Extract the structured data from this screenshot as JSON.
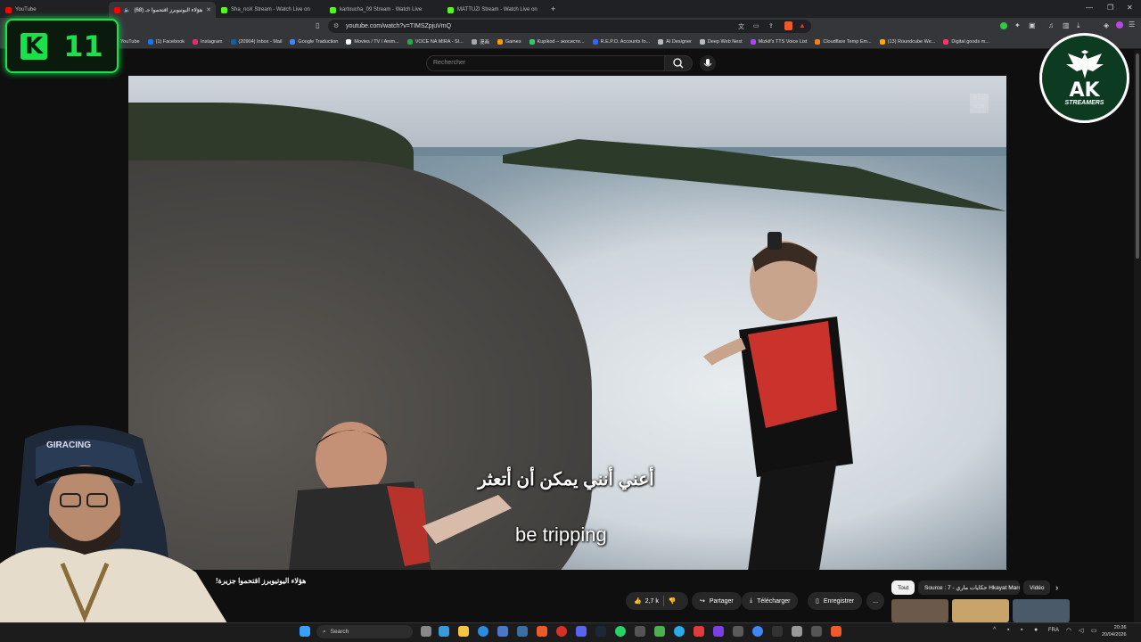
{
  "browser": {
    "tabs": [
      {
        "title": "YouTube",
        "active": false,
        "favicon_color": "#ff0000"
      },
      {
        "title": "هؤلاء اليوتيوبرز اقتحموا جـ (68)",
        "active": true,
        "favicon_color": "#ff0000"
      },
      {
        "title": "Sha_noX Stream - Watch Live on",
        "active": false,
        "favicon_color": "#53fc18"
      },
      {
        "title": "kartoucha_09 Stream - Watch Live",
        "active": false,
        "favicon_color": "#53fc18"
      },
      {
        "title": "MATTUZI Stream - Watch Live on",
        "active": false,
        "favicon_color": "#53fc18"
      }
    ],
    "new_tab": "+",
    "url": "youtube.com/watch?v=TIMSZpjuVmQ",
    "bookmarks": [
      {
        "label": "YouTube",
        "color": "#ff0000"
      },
      {
        "label": "(1) Facebook",
        "color": "#1877f2"
      },
      {
        "label": "Instagram",
        "color": "#e1306c"
      },
      {
        "label": "(20904) Inbox - Mail",
        "color": "#0a64ad"
      },
      {
        "label": "Google Traduction",
        "color": "#4285f4"
      },
      {
        "label": "Movies / TV / Anim...",
        "color": "#ffffff"
      },
      {
        "label": "VOCE NA MIRA - SI...",
        "color": "#22aa44"
      },
      {
        "label": "漫画",
        "color": "#aaaaaa"
      },
      {
        "label": "Games",
        "color": "#ff9900"
      },
      {
        "label": "Kupikod – экосисте...",
        "color": "#33cc66"
      },
      {
        "label": "R.E.P.O. Accounts fo...",
        "color": "#3366ff"
      },
      {
        "label": "AI Designer",
        "color": "#bbbbbb"
      },
      {
        "label": "Deep Web Nest",
        "color": "#bbbbbb"
      },
      {
        "label": "Mizkif's TTS Voice List",
        "color": "#aa44ff"
      },
      {
        "label": "Cloudflare Temp Em...",
        "color": "#f48120"
      },
      {
        "label": "(13) Roundcube We...",
        "color": "#ffaa00"
      },
      {
        "label": "Digital goods m...",
        "color": "#ff3366"
      }
    ]
  },
  "youtube": {
    "search_placeholder": "Rechercher",
    "video": {
      "watermark": "RTX\nVSR",
      "subtitle_ar": "أعني أنني يمكن أن أتعثر",
      "subtitle_en": "be tripping",
      "title": "هؤلاء اليوتيوبرز اقتحموا جزيرة!"
    },
    "actions": {
      "likes": "2,7 k",
      "share": "Partager",
      "download": "Télécharger",
      "save": "Enregistrer",
      "more": "..."
    },
    "chips": [
      {
        "label": "Tout",
        "active": true
      },
      {
        "label": "Source : 7 - حكايات ماري Hkayat Maro",
        "active": false
      },
      {
        "label": "Vidéo",
        "active": false
      }
    ]
  },
  "overlay": {
    "kick_badge_letter": "K",
    "kick_badge_number": "11",
    "logo_title": "AK",
    "logo_subtitle": "STREAMERS",
    "webcam_chair_brand": "GIRACING"
  },
  "taskbar": {
    "search_label": "Search",
    "language": "FRA",
    "time": "20:36",
    "date": "20/04/2026"
  },
  "colors": {
    "kick_green": "#18e14a",
    "logo_green": "#0d3b22"
  }
}
